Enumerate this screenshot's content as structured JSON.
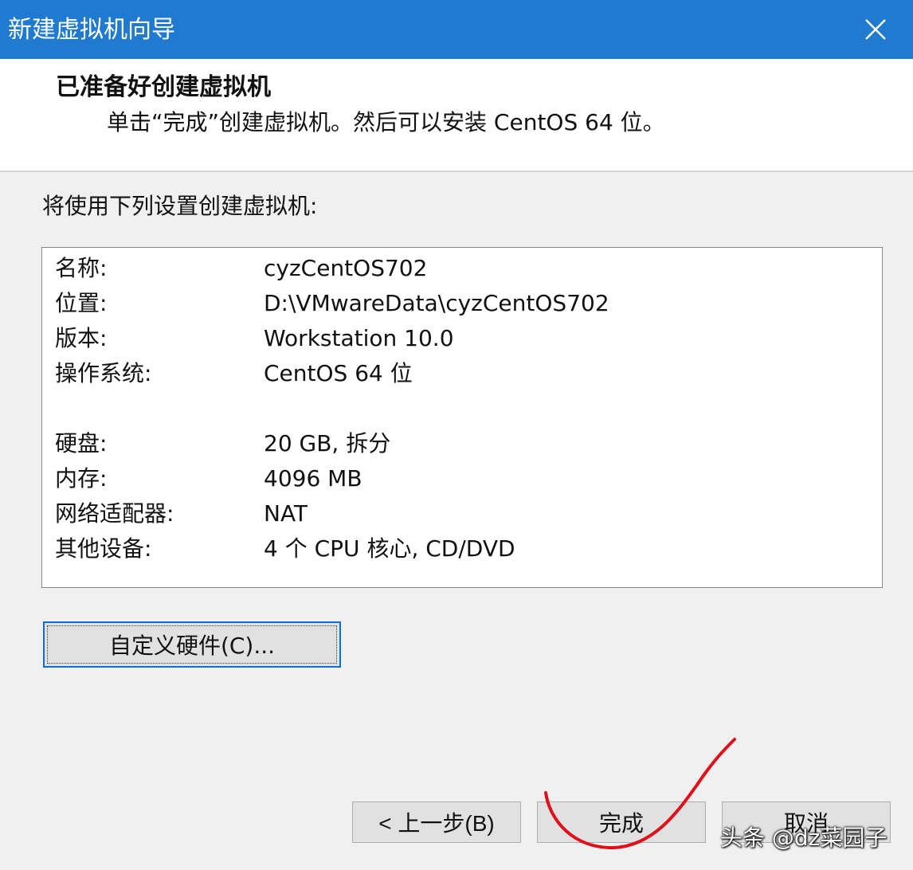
{
  "window": {
    "title": "新建虚拟机向导",
    "titlebar_color": "#1f7ad0",
    "close_icon": "close-icon"
  },
  "header": {
    "title": "已准备好创建虚拟机",
    "subtitle": "单击“完成”创建虚拟机。然后可以安装 CentOS 64 位。"
  },
  "body": {
    "intro": "将使用下列设置创建虚拟机:",
    "summary": {
      "rows": [
        {
          "key": "名称:",
          "value": "cyzCentOS702"
        },
        {
          "key": "位置:",
          "value": "D:\\VMwareData\\cyzCentOS702"
        },
        {
          "key": "版本:",
          "value": "Workstation 10.0"
        },
        {
          "key": "操作系统:",
          "value": "CentOS 64 位"
        },
        {
          "key": "硬盘:",
          "value": "20 GB, 拆分"
        },
        {
          "key": "内存:",
          "value": "4096 MB"
        },
        {
          "key": "网络适配器:",
          "value": "NAT"
        },
        {
          "key": "其他设备:",
          "value": "4 个 CPU 核心, CD/DVD"
        }
      ]
    },
    "customize_button": "自定义硬件(C)..."
  },
  "footer": {
    "back_button": "< 上一步(B)",
    "finish_button": "完成",
    "cancel_button": "取消"
  },
  "annotation": {
    "color": "#e0101a",
    "shape": "freehand circle around finish button"
  },
  "watermark": "头条 @dz菜园子"
}
